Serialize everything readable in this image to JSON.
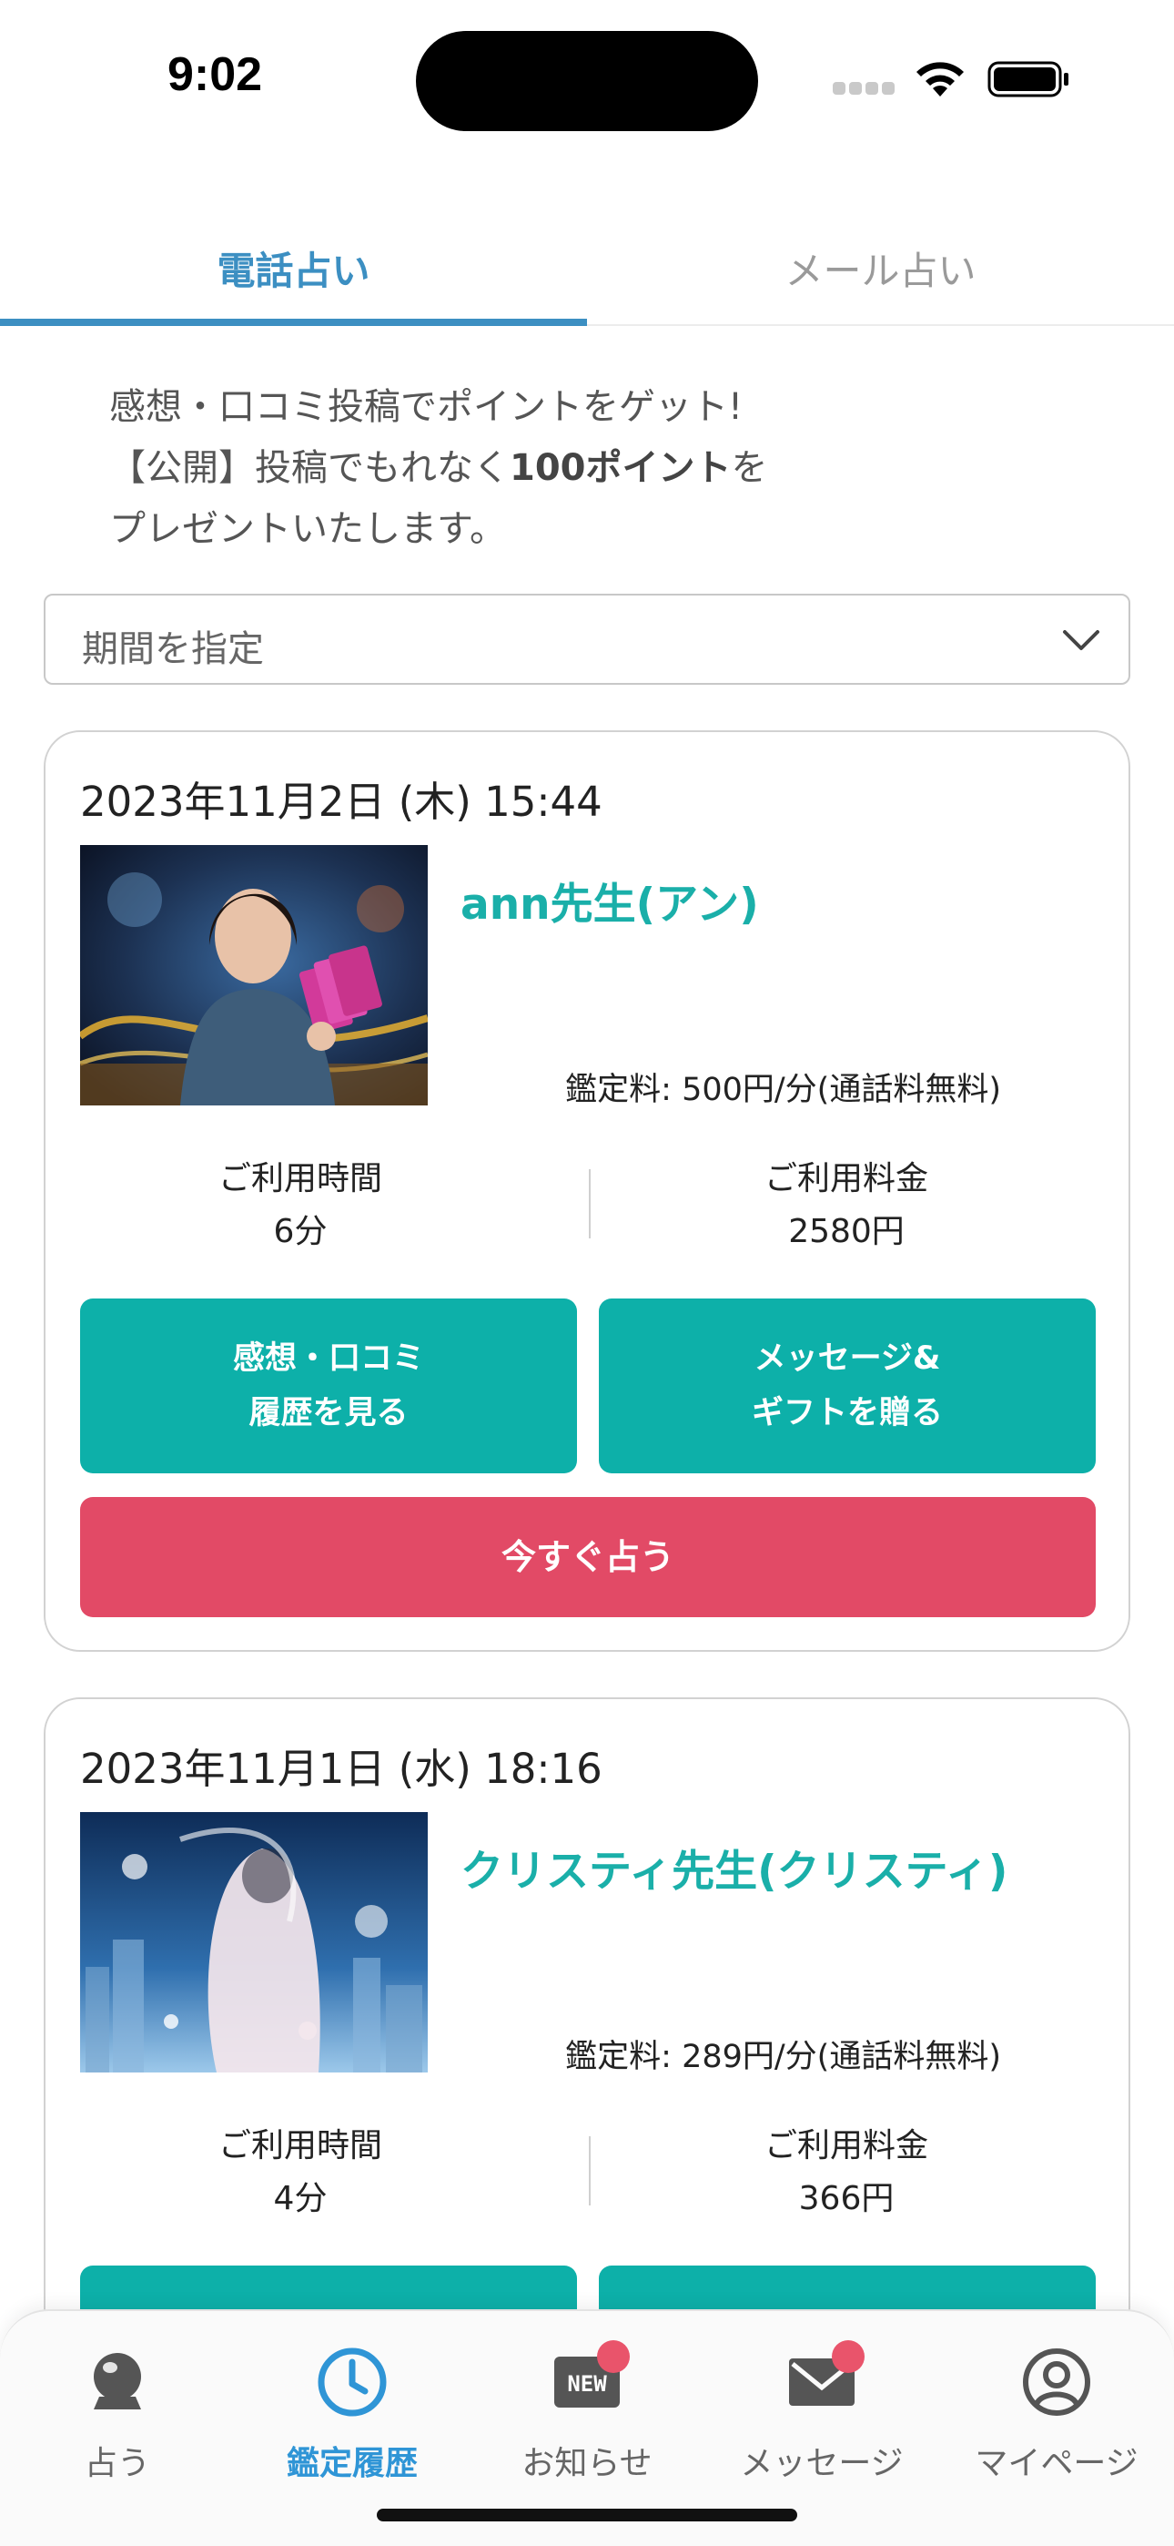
{
  "status_bar": {
    "time": "9:02"
  },
  "tabs": [
    {
      "label": "電話占い",
      "active": true
    },
    {
      "label": "メール占い",
      "active": false
    }
  ],
  "promo": {
    "line1": "感想・口コミ投稿でポイントをゲット!",
    "line2_pre": "【公開】投稿でもれなく",
    "line2_bold": "100ポイント",
    "line2_post": "を",
    "line3": "プレゼントいたします。"
  },
  "period_select": {
    "value": "期間を指定",
    "icon": "chevron-down-icon"
  },
  "history": [
    {
      "date": "2023年11月2日 (木) 15:44",
      "name": "ann先生(アン)",
      "fee": "鑑定料: 500円/分(通話料無料)",
      "time_label": "ご利用時間",
      "time_value": "6分",
      "price_label": "ご利用料金",
      "price_value": "2580円",
      "review_button": "感想・口コミ\n履歴を見る",
      "gift_button": "メッセージ&\nギフトを贈る",
      "fortune_button": "今すぐ占う"
    },
    {
      "date": "2023年11月1日 (水) 18:16",
      "name": "クリスティ先生(クリスティ)",
      "fee": "鑑定料: 289円/分(通話料無料)",
      "time_label": "ご利用時間",
      "time_value": "4分",
      "price_label": "ご利用料金",
      "price_value": "366円"
    }
  ],
  "tab_bar": [
    {
      "label": "占う",
      "icon": "crystal-ball-icon",
      "active": false,
      "badge": false
    },
    {
      "label": "鑑定履歴",
      "icon": "clock-icon",
      "active": true,
      "badge": false
    },
    {
      "label": "お知らせ",
      "icon": "new-badge-icon",
      "active": false,
      "badge": true
    },
    {
      "label": "メッセージ",
      "icon": "envelope-icon",
      "active": false,
      "badge": true
    },
    {
      "label": "マイページ",
      "icon": "user-circle-icon",
      "active": false,
      "badge": false
    }
  ],
  "colors": {
    "accent_blue": "#3c8fc2",
    "teal": "#0db0a9",
    "pink": "#e24a66",
    "badge_red": "#e9546b"
  }
}
